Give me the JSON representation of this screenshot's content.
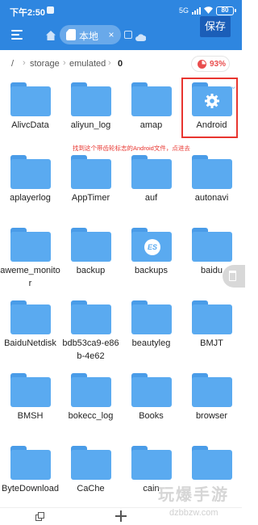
{
  "status_bar": {
    "time": "下午2:50",
    "network": "5G",
    "battery": "80"
  },
  "toolbar": {
    "tab_label": "本地",
    "tab_close": "×",
    "save_label": "保存"
  },
  "path": {
    "root": "/",
    "segments": [
      "storage",
      "emulated",
      "0"
    ],
    "storage_used": "93%"
  },
  "folders": [
    {
      "name": "AlivcData",
      "icon": "folder-icon"
    },
    {
      "name": "aliyun_log",
      "icon": "folder-icon"
    },
    {
      "name": "amap",
      "icon": "folder-icon"
    },
    {
      "name": "Android",
      "icon": "gear-folder-icon"
    },
    {
      "name": "aplayerlog",
      "icon": "folder-icon"
    },
    {
      "name": "AppTimer",
      "icon": "folder-icon"
    },
    {
      "name": "auf",
      "icon": "folder-icon"
    },
    {
      "name": "autonavi",
      "icon": "folder-icon"
    },
    {
      "name": "aweme_monitor",
      "icon": "folder-icon"
    },
    {
      "name": "backup",
      "icon": "folder-icon"
    },
    {
      "name": "backups",
      "icon": "es-folder-icon",
      "badge": "ES"
    },
    {
      "name": "baidu",
      "icon": "folder-icon"
    },
    {
      "name": "BaiduNetdisk",
      "icon": "folder-icon"
    },
    {
      "name": "bdb53ca9-e86b-4e62",
      "icon": "folder-icon"
    },
    {
      "name": "beautyleg",
      "icon": "folder-icon"
    },
    {
      "name": "BMJT",
      "icon": "folder-icon"
    },
    {
      "name": "BMSH",
      "icon": "folder-icon"
    },
    {
      "name": "bokecc_log",
      "icon": "folder-icon"
    },
    {
      "name": "Books",
      "icon": "folder-icon"
    },
    {
      "name": "browser",
      "icon": "folder-icon"
    },
    {
      "name": "ByteDownload",
      "icon": "folder-icon"
    },
    {
      "name": "CaChe",
      "icon": "folder-icon"
    },
    {
      "name": "cain",
      "icon": "folder-icon"
    },
    {
      "name": "",
      "icon": "folder-icon"
    }
  ],
  "annotation": "找到这个带齿轮标志的Android文件，点进去",
  "watermark": {
    "main": "玩爆手游",
    "sub": "dzbbzw.com"
  },
  "colors": {
    "primary": "#2e86e0",
    "folder": "#5aaaf0",
    "annotation": "#e8352f",
    "save": "#1b5eb8"
  }
}
